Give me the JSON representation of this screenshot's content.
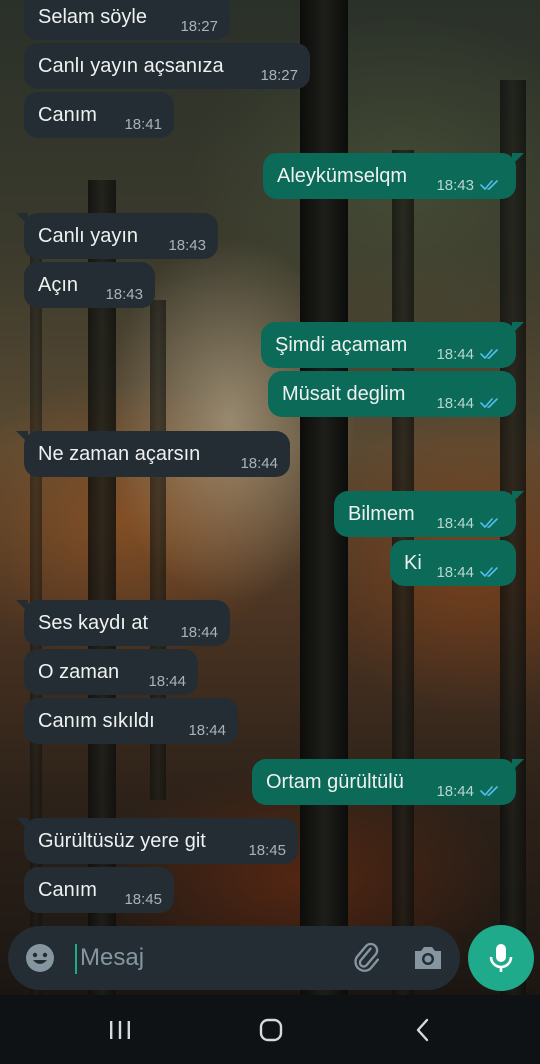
{
  "chat": {
    "messages": [
      {
        "dir": "in",
        "text": "Selam söyle",
        "time": "18:27",
        "read": false
      },
      {
        "dir": "in",
        "text": "Canlı yayın açsanıza",
        "time": "18:27",
        "read": false
      },
      {
        "dir": "in",
        "text": "Canım",
        "time": "18:41",
        "read": false
      },
      {
        "dir": "out",
        "text": "Aleykümselqm",
        "time": "18:43",
        "read": true
      },
      {
        "dir": "in",
        "text": "Canlı yayın",
        "time": "18:43",
        "read": false
      },
      {
        "dir": "in",
        "text": "Açın",
        "time": "18:43",
        "read": false
      },
      {
        "dir": "out",
        "text": "Şimdi açamam",
        "time": "18:44",
        "read": true
      },
      {
        "dir": "out",
        "text": "Müsait deglim",
        "time": "18:44",
        "read": true
      },
      {
        "dir": "in",
        "text": "Ne zaman açarsın",
        "time": "18:44",
        "read": false
      },
      {
        "dir": "out",
        "text": "Bilmem",
        "time": "18:44",
        "read": true
      },
      {
        "dir": "out",
        "text": "Ki",
        "time": "18:44",
        "read": true
      },
      {
        "dir": "in",
        "text": "Ses kaydı at",
        "time": "18:44",
        "read": false
      },
      {
        "dir": "in",
        "text": "O zaman",
        "time": "18:44",
        "read": false
      },
      {
        "dir": "in",
        "text": "Canım sıkıldı",
        "time": "18:44",
        "read": false
      },
      {
        "dir": "out",
        "text": "Ortam gürültülü",
        "time": "18:44",
        "read": true
      },
      {
        "dir": "in",
        "text": "Gürültüsüz yere git",
        "time": "18:45",
        "read": false
      },
      {
        "dir": "in",
        "text": "Canım",
        "time": "18:45",
        "read": false
      }
    ]
  },
  "composer": {
    "placeholder": "Mesaj",
    "value": "",
    "icons": [
      "emoji-icon",
      "paperclip-icon",
      "camera-icon",
      "microphone-icon"
    ]
  },
  "nav": {
    "icons": [
      "recent-apps-icon",
      "home-icon",
      "back-icon"
    ]
  },
  "colors": {
    "incoming_bubble": "#232d33",
    "outgoing_bubble": "#0b6a58",
    "accent": "#1faa8c",
    "read_tick": "#53bdeb"
  }
}
